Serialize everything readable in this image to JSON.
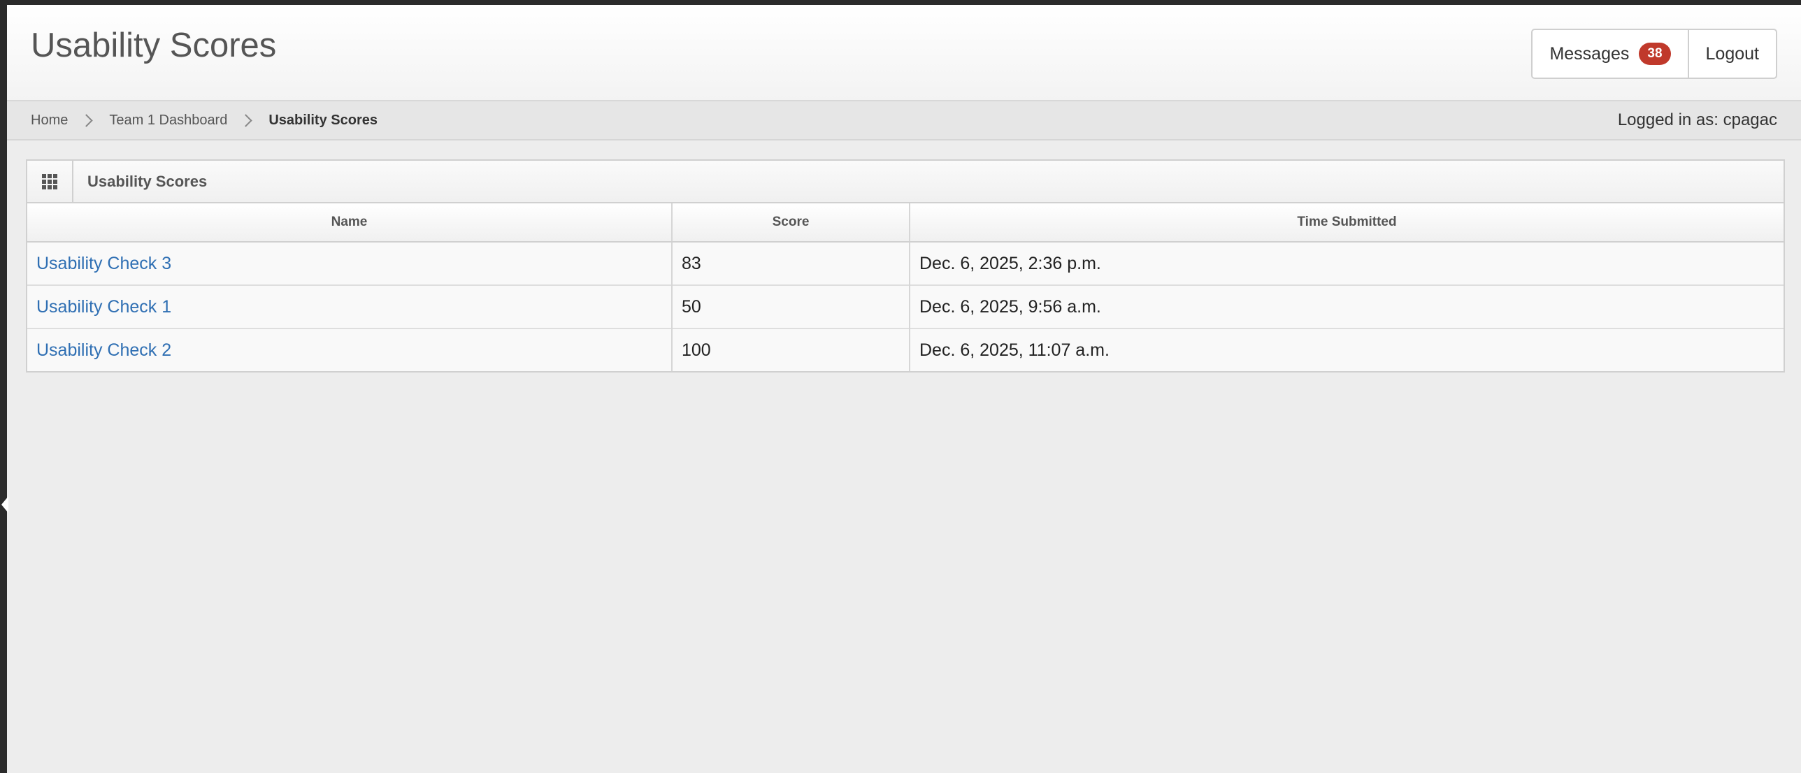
{
  "header": {
    "title": "Usability Scores",
    "messages_label": "Messages",
    "messages_count": "38",
    "logout_label": "Logout"
  },
  "breadcrumb": {
    "items": [
      "Home",
      "Team 1 Dashboard",
      "Usability Scores"
    ]
  },
  "user": {
    "logged_in_text": "Logged in as: cpagac"
  },
  "panel": {
    "title": "Usability Scores",
    "icon": "grid-icon"
  },
  "table": {
    "columns": [
      "Name",
      "Score",
      "Time Submitted"
    ],
    "rows": [
      {
        "name": "Usability Check 3",
        "score": "83",
        "time": "Dec. 6, 2025, 2:36 p.m."
      },
      {
        "name": "Usability Check 1",
        "score": "50",
        "time": "Dec. 6, 2025, 9:56 a.m."
      },
      {
        "name": "Usability Check 2",
        "score": "100",
        "time": "Dec. 6, 2025, 11:07 a.m."
      }
    ]
  },
  "colors": {
    "link": "#2f6fb3",
    "badge": "#c0392b"
  }
}
